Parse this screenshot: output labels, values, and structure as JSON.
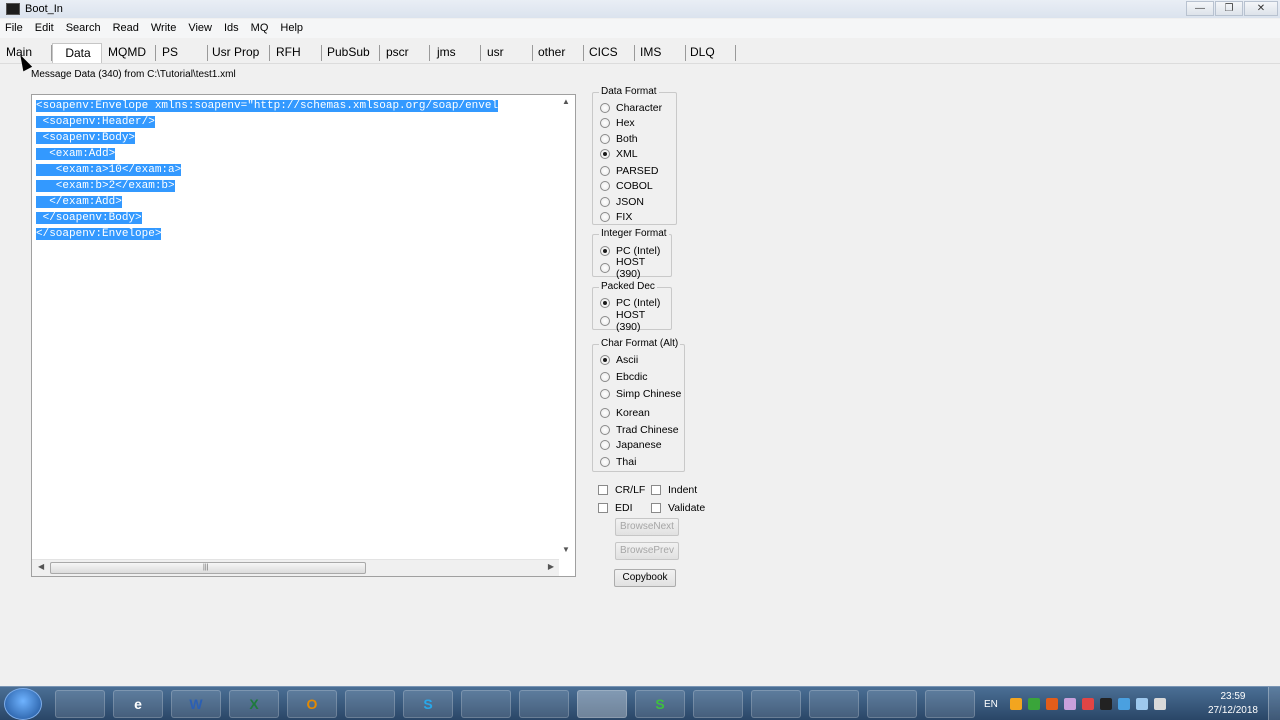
{
  "window": {
    "title": "Boot_In",
    "controls": {
      "minimize": "—",
      "maximize": "❐",
      "close": "✕"
    }
  },
  "menu": [
    "File",
    "Edit",
    "Search",
    "Read",
    "Write",
    "View",
    "Ids",
    "MQ",
    "Help"
  ],
  "tabs": [
    "Main",
    "Data",
    "MQMD",
    "PS",
    "Usr Prop",
    "RFH",
    "PubSub",
    "pscr",
    "jms",
    "usr",
    "other",
    "CICS",
    "IMS",
    "DLQ"
  ],
  "active_tab": "Data",
  "message_info": "Message Data (340) from C:\\Tutorial\\test1.xml",
  "editor": {
    "lines": [
      "<soapenv:Envelope xmlns:soapenv=\"http://schemas.xmlsoap.org/soap/envel",
      " <soapenv:Header/>",
      " <soapenv:Body>",
      "  <exam:Add>",
      "   <exam:a>10</exam:a>",
      "   <exam:b>2</exam:b>",
      "  </exam:Add>",
      " </soapenv:Body>",
      "</soapenv:Envelope>"
    ]
  },
  "data_format": {
    "label": "Data Format",
    "options": [
      "Character",
      "Hex",
      "Both",
      "XML",
      "PARSED",
      "COBOL",
      "JSON",
      "FIX"
    ],
    "selected": "XML"
  },
  "integer_format": {
    "label": "Integer Format",
    "options": [
      "PC (Intel)",
      "HOST (390)"
    ],
    "selected": "PC (Intel)"
  },
  "packed_dec": {
    "label": "Packed Dec",
    "options": [
      "PC (Intel)",
      "HOST (390)"
    ],
    "selected": "PC (Intel)"
  },
  "char_format": {
    "label": "Char Format (Alt)",
    "options": [
      "Ascii",
      "Ebcdic",
      "Simp Chinese",
      "Korean",
      "Trad Chinese",
      "Japanese",
      "Thai"
    ],
    "selected": "Ascii"
  },
  "checkboxes": {
    "crlf": "CR/LF",
    "indent": "Indent",
    "edi": "EDI",
    "validate": "Validate"
  },
  "buttons": {
    "browse_next": "BrowseNext",
    "browse_prev": "BrowsePrev",
    "copybook": "Copybook"
  },
  "taskbar": {
    "apps": [
      "",
      "e",
      "W",
      "X",
      "O",
      "",
      "S",
      "",
      "",
      "",
      "S",
      "",
      "",
      "",
      "",
      ""
    ],
    "language": "EN",
    "time": "23:59",
    "date": "27/12/2018"
  }
}
